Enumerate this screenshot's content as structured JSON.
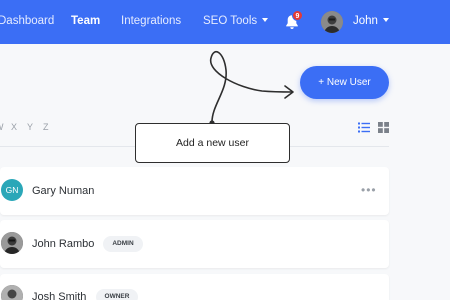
{
  "nav": {
    "dashboard": "Dashboard",
    "team": "Team",
    "integrations": "Integrations",
    "seo_tools": "SEO Tools"
  },
  "notifications": {
    "count": "9",
    "icon": "bell-icon"
  },
  "user": {
    "name": "John"
  },
  "actions": {
    "new_user_label": "+ New User"
  },
  "alphabet_filter": [
    "W",
    "X",
    "Y",
    "Z"
  ],
  "tooltip": {
    "text": "Add a new user"
  },
  "members": [
    {
      "initials": "GN",
      "name": "Gary Numan",
      "role": ""
    },
    {
      "initials": "",
      "name": "John Rambo",
      "role": "ADMIN"
    },
    {
      "initials": "",
      "name": "Josh Smith",
      "role": "OWNER"
    }
  ],
  "colors": {
    "primary": "#3b6ef5",
    "badge": "#e53935",
    "avatar_teal": "#2aa7b8"
  }
}
